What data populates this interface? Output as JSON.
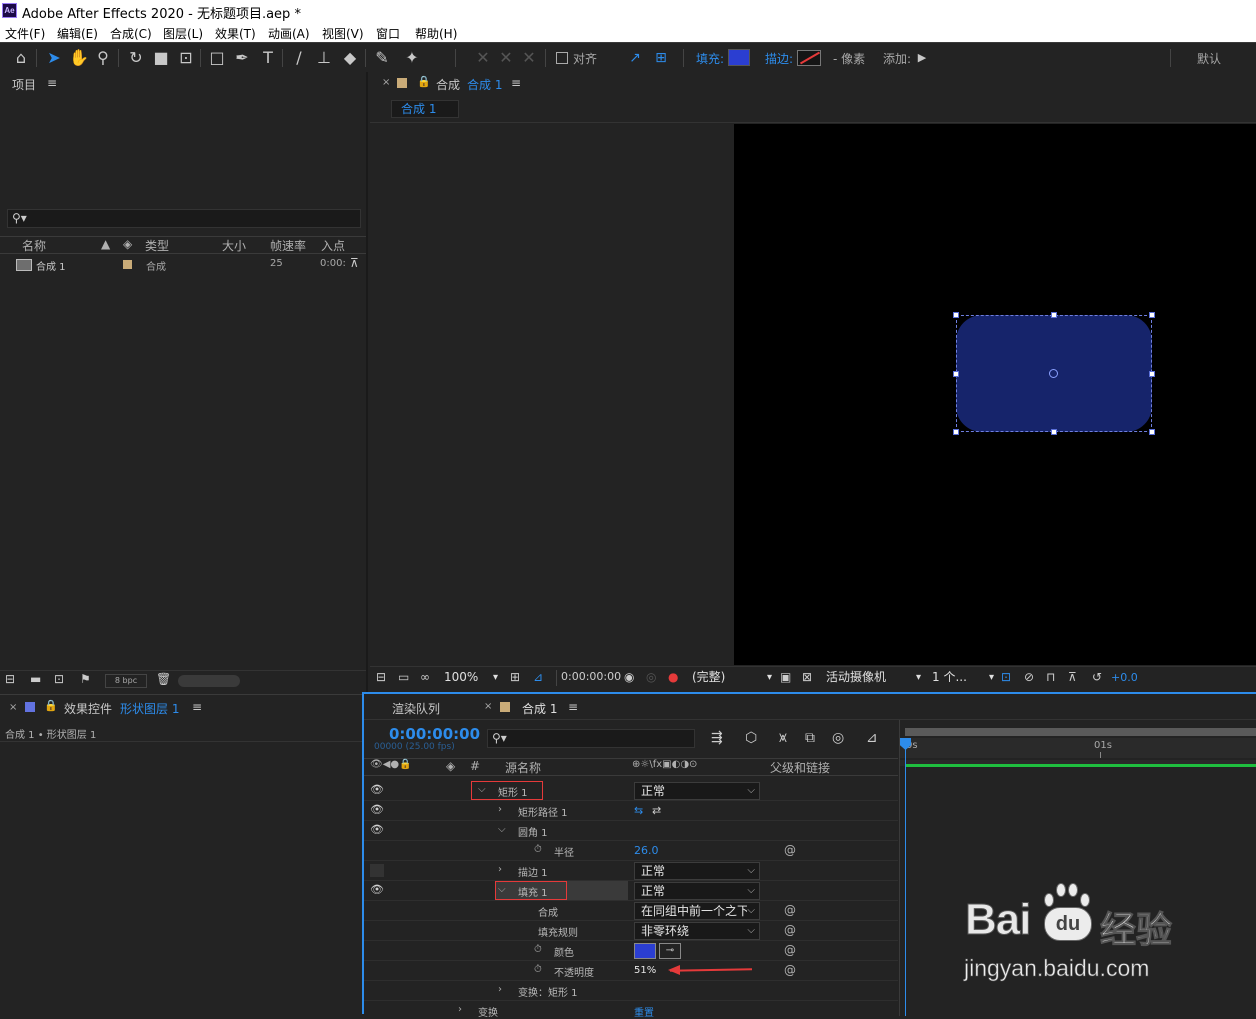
{
  "window": {
    "title": "Adobe After Effects 2020 - 无标题项目.aep *",
    "logo_text": "Ae"
  },
  "menu": [
    "文件(F)",
    "编辑(E)",
    "合成(C)",
    "图层(L)",
    "效果(T)",
    "动画(A)",
    "视图(V)",
    "窗口",
    "帮助(H)"
  ],
  "toolbar": {
    "align_label": "对齐",
    "fill_label": "填充:",
    "stroke_label": "描边:",
    "pixels_label": "- 像素",
    "add_label": "添加:",
    "workspace": "默认"
  },
  "colors": {
    "accent": "#2d8ceb",
    "fill_swatch": "#2b3ed1",
    "shape_fill": "#16246b",
    "marker": "#e53a3a",
    "timeline_bar": "#1fbf3f"
  },
  "project": {
    "title": "项目",
    "search_placeholder": "",
    "columns": [
      "名称",
      "类型",
      "大小",
      "帧速率",
      "入点"
    ],
    "items": [
      {
        "name": "合成 1",
        "type": "合成",
        "fps": "25",
        "in": "0:00:"
      }
    ],
    "footer_bpc": "8 bpc"
  },
  "comp_viewer": {
    "panel_label": "合成",
    "comp_name": "合成 1",
    "tab": "合成 1",
    "zoom": "100%",
    "timecode": "0:00:00:00",
    "resolution": "(完整)",
    "camera": "活动摄像机",
    "views": "1 个...",
    "exposure": "+0.0"
  },
  "effect_controls": {
    "title": "效果控件",
    "layer_name": "形状图层 1",
    "breadcrumb": "合成 1 • 形状图层 1"
  },
  "timeline": {
    "render_queue_tab": "渲染队列",
    "comp_tab": "合成 1",
    "timecode": "0:00:00:00",
    "frame_info": "00000 (25.00 fps)",
    "source_name_header": "源名称",
    "parent_header": "父级和链接",
    "ruler": [
      "0s",
      "01s"
    ],
    "rows": [
      {
        "label": "矩形 1",
        "mode": "正常"
      },
      {
        "label": "矩形路径 1"
      },
      {
        "label": "圆角 1"
      },
      {
        "label": "半径",
        "value": "26.0"
      },
      {
        "label": "描边 1",
        "mode": "正常"
      },
      {
        "label": "填充 1",
        "mode": "正常"
      },
      {
        "label": "合成",
        "value": "在同组中前一个之下"
      },
      {
        "label": "填充规则",
        "value": "非零环绕"
      },
      {
        "label": "颜色"
      },
      {
        "label": "不透明度",
        "value": "51%"
      },
      {
        "label": "变换：矩形 1"
      },
      {
        "label": "变换",
        "value": "重置"
      }
    ]
  },
  "watermark": {
    "brand": "Bai",
    "brand2": "du",
    "suffix": "经验",
    "url": "jingyan.baidu.com"
  }
}
